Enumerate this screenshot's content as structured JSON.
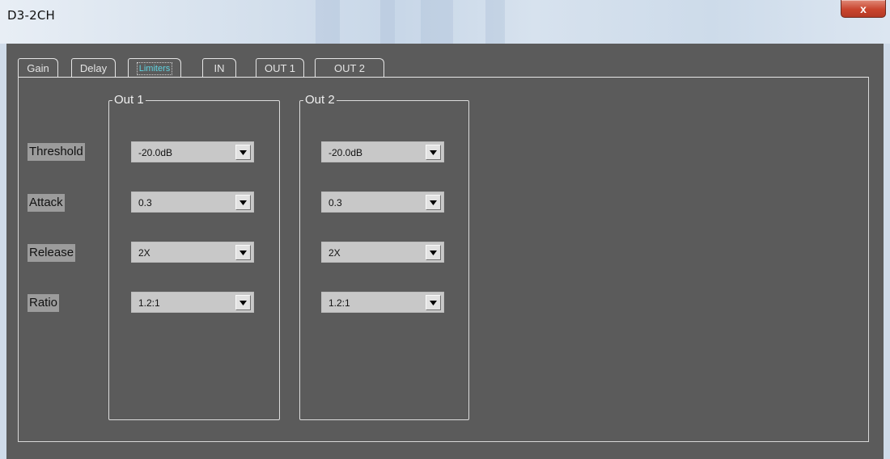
{
  "window": {
    "title": "D3-2CH",
    "close_label": "x"
  },
  "tabs": [
    {
      "label": "Gain",
      "active": false
    },
    {
      "label": "Delay",
      "active": false
    },
    {
      "label": "Limiters",
      "active": true
    },
    {
      "label": "IN",
      "active": false
    },
    {
      "label": "OUT 1",
      "active": false
    },
    {
      "label": "OUT 2",
      "active": false
    }
  ],
  "params": [
    {
      "label": "Threshold"
    },
    {
      "label": "Attack"
    },
    {
      "label": "Release"
    },
    {
      "label": "Ratio"
    }
  ],
  "groups": [
    {
      "legend": "Out 1",
      "values": [
        "-20.0dB",
        "0.3",
        "2X",
        "1.2:1"
      ]
    },
    {
      "legend": "Out 2",
      "values": [
        "-20.0dB",
        "0.3",
        "2X",
        "1.2:1"
      ]
    }
  ],
  "icons": {
    "close": "close-icon",
    "dropdown": "chevron-down-icon"
  },
  "colors": {
    "background": "#5b5b5b",
    "active_tab_text": "#5fd3e0",
    "label_bg": "#9c9c9c",
    "combo_bg": "#c8c8c8",
    "close_button": "#c9452e"
  }
}
